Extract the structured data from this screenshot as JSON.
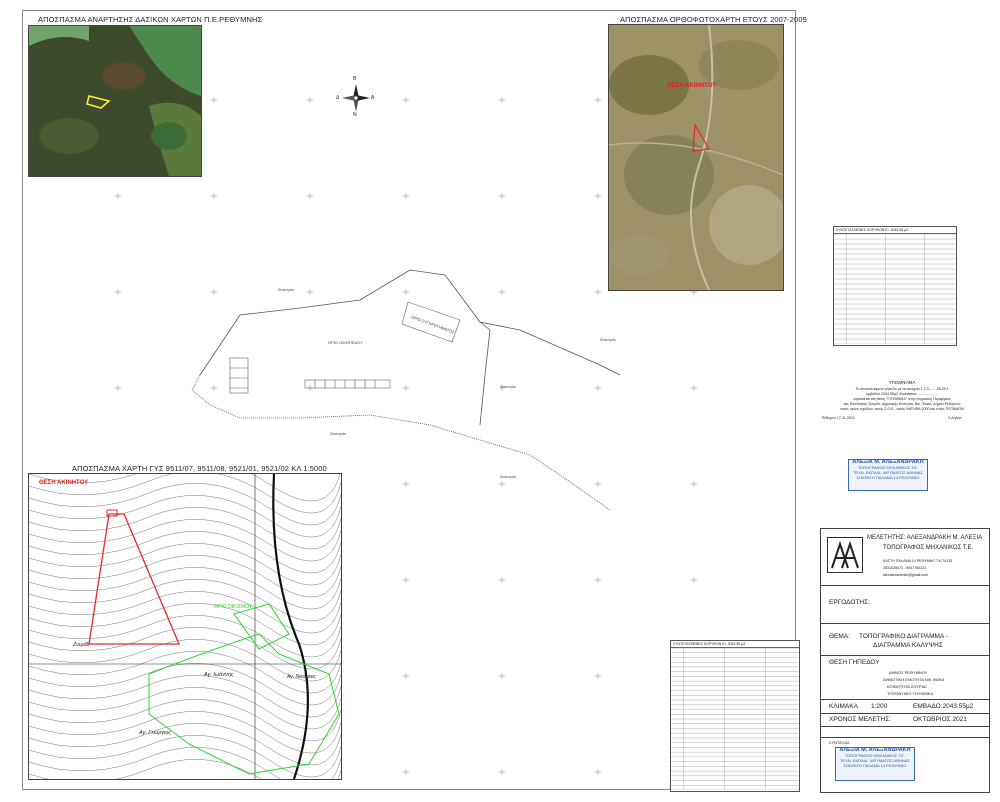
{
  "maps": {
    "top_left_title": "ΑΠΟΣΠΑΣΜΑ ΑΝΑΡΤΗΣΗΣ ΔΑΣΙΚΩΝ ΧΑΡΤΩΝ Π.Ε.ΡΕΘΥΜΝΗΣ",
    "top_right_title": "ΑΠΟΣΠΑΣΜΑ ΟΡΘΟΦΩΤΟΧΑΡΤΗ ΕΤΟΥΣ 2007-2009",
    "bottom_left_title": "ΑΠΟΣΠΑΣΜΑ ΧΑΡΤΗ ΓΥΣ 9511/07, 9511/08, 9521/01, 9521/02 ΚΛ 1:5000",
    "area_label_ortho": "ΘΕΣΗ ΑΚΙΝΗΤΟΥ",
    "area_label_gys": "ΘΕΣΗ ΑΚΙΝΗΤΟΥ",
    "settlement_label": "ΟΡΙΟ ΟΙΚΙΣΜΟΥ",
    "place_labels": [
      "Ζουρίδι",
      "Αγ. Γεώργιος",
      "Αγ. Ιωάννης",
      "Αγ. Νικόλαος"
    ]
  },
  "plan": {
    "building_label": "ΟΡΙΟ ΣΥΓΚΡΟΤΗΜΑΤΟΣ",
    "area_note": "ΟΡΙΟ ΟΙΚΟΠΕΔΟΥ",
    "neighbor_labels": [
      "Ιδιοκτησία",
      "Ιδιοκτησία",
      "Ιδιοκτησία",
      "Ιδιοκτησία",
      "Ιδιοκτησία"
    ]
  },
  "legend": {
    "title": "ΥΠΟΜΝΗΜΑ",
    "lines": [
      "Το αποτυπούμενο γήπεδο με τα στοιχεία 1,2,3,......,28,29,1",
      "εμβαδού 2043.55μ2 ιδιοκτησίας ....................",
      "ευρίσκεται στη θέση \"ΓΟΥΜΝΙΚΑ\" στην κτηματική Περιφέρεια",
      "της Κοινότητας Ζουρίδι, Δημοτικής Ενότητας Νικ. Φωκά, Δήμου Ρεθύμνου",
      "εκτός ορίων σχεδίου, εκτός Ζ.Ο.Ε., εκτός NATURA 2000 και εντός ΠΟΤΑΜΟΝ",
      "Ρέθυμνο 17-11-2021",
      "Ο Δηλών"
    ]
  },
  "coord_table": {
    "header": [
      "Α/Α",
      "X",
      "Y",
      "Πλευρά"
    ],
    "title": "ΣΥΝΤΕΤΑΓΜΕΝΕΣ ΚΟΡΥΦΩΝ   Ε= 2043.55 μ2"
  },
  "title_block": {
    "engineer_label": "ΜΕΛΕΤΗΤΗΣ:",
    "engineer_name": "ΑΛΕΞΑΝΔΡΑΚΗ Μ. ΑΛΕΞΙΑ",
    "profession": "ΤΟΠΟΓΡΑΦΟΣ ΜΗΧΑΝΙΚΟΣ Τ.Ε.",
    "address": "ΚΑΣΤΗ ΠΑΛΑΜΑ 14   ΡΕΘΥΜΝΟ Τ.Κ.74133",
    "phone": "2831028073 - 6937760323",
    "email": "alexalexandraki@gmail.com",
    "client_label": "ΕΡΓΟΔΟΤΗΣ:",
    "subject_label": "ΘΕΜΑ:",
    "subject_line1": "ΤΟΠΟΓΡΑΦΙΚΟ ΔΙΑΓΡΑΜΜΑ -",
    "subject_line2": "ΔΙΑΓΡΑΜΜΑ ΚΑΛΥΨΗΣ",
    "site_label": "ΘΕΣΗ ΓΗΠΕΔΟΥ",
    "site_lines": [
      "ΔΗΜΟΣ ΡΕΘΥΜΝΟΥ",
      "ΔΗΜΟΤΙΚΗ ΕΝΟΤΗΤΑ ΝΙΚ.ΦΩΚΑ",
      "ΚΟΙΝΟΤΗΤΑ ΖΟΥΡΙΔΙ",
      "ΤΟΠΩΝΥΜΙΟ ΓΟΥΜΝΙΚΑ"
    ],
    "scale_label": "ΚΛΙΜΑΚΑ",
    "scale_value": "1:200",
    "area_label": "ΕΜΒΑΔΟ:",
    "area_value": "2043.55μ2",
    "date_label": "ΧΡΟΝΟΣ ΜΕΛΕΤΗΣ:",
    "date_value": "ΟΚΤΩΒΡΙΟΣ 2021",
    "signatures_label": "ΣΥΝΤΑΞΑΣ"
  },
  "stamp": {
    "line1": "ΑΛΕΞΙΑ Μ. ΑΛΕΞΑΝΔΡΑΚΗ",
    "line2": "ΤΟΠΟΓΡΑΦΟΣ ΜΗΧΑΝΙΚΟΣ Τ.Ε.",
    "line3": "ΤΕΧΝ. ΕΚΠΑΙΔ. ΙΔΡΥΜΑΤΟΣ ΑΘΗΝΑΣ",
    "line4": "ΜΕΛΟΣ Τ.Ε.Ε.",
    "line5": "ΣΩΚΡΑΤΗ ΠΑΛΑΜΑ 14 ΡΕΘΥΜΝΟ",
    "line6": "Α.Μ.Μ. 74133",
    "line7": "ΤΗΛ. 2831028073"
  },
  "compass": {
    "n": "Β",
    "s": "Ν",
    "e": "Α",
    "w": "Δ"
  }
}
